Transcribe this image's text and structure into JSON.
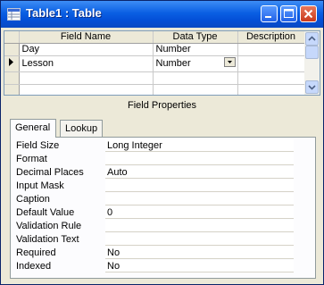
{
  "window": {
    "title": "Table1 : Table"
  },
  "grid": {
    "headers": [
      "Field Name",
      "Data Type",
      "Description"
    ],
    "rows": [
      {
        "field_name": "Day",
        "data_type": "Number",
        "description": ""
      },
      {
        "field_name": "Lesson",
        "data_type": "Number",
        "description": ""
      }
    ]
  },
  "field_properties": {
    "header": "Field Properties",
    "tabs": [
      "General",
      "Lookup"
    ],
    "active_tab": "General",
    "properties": [
      {
        "label": "Field Size",
        "value": "Long Integer"
      },
      {
        "label": "Format",
        "value": ""
      },
      {
        "label": "Decimal Places",
        "value": "Auto"
      },
      {
        "label": "Input Mask",
        "value": ""
      },
      {
        "label": "Caption",
        "value": ""
      },
      {
        "label": "Default Value",
        "value": "0"
      },
      {
        "label": "Validation Rule",
        "value": ""
      },
      {
        "label": "Validation Text",
        "value": ""
      },
      {
        "label": "Required",
        "value": "No"
      },
      {
        "label": "Indexed",
        "value": "No"
      }
    ]
  },
  "colors": {
    "titlebar": "#0a5fe3",
    "window_bg": "#ece9d8",
    "close_button": "#c9391c"
  }
}
